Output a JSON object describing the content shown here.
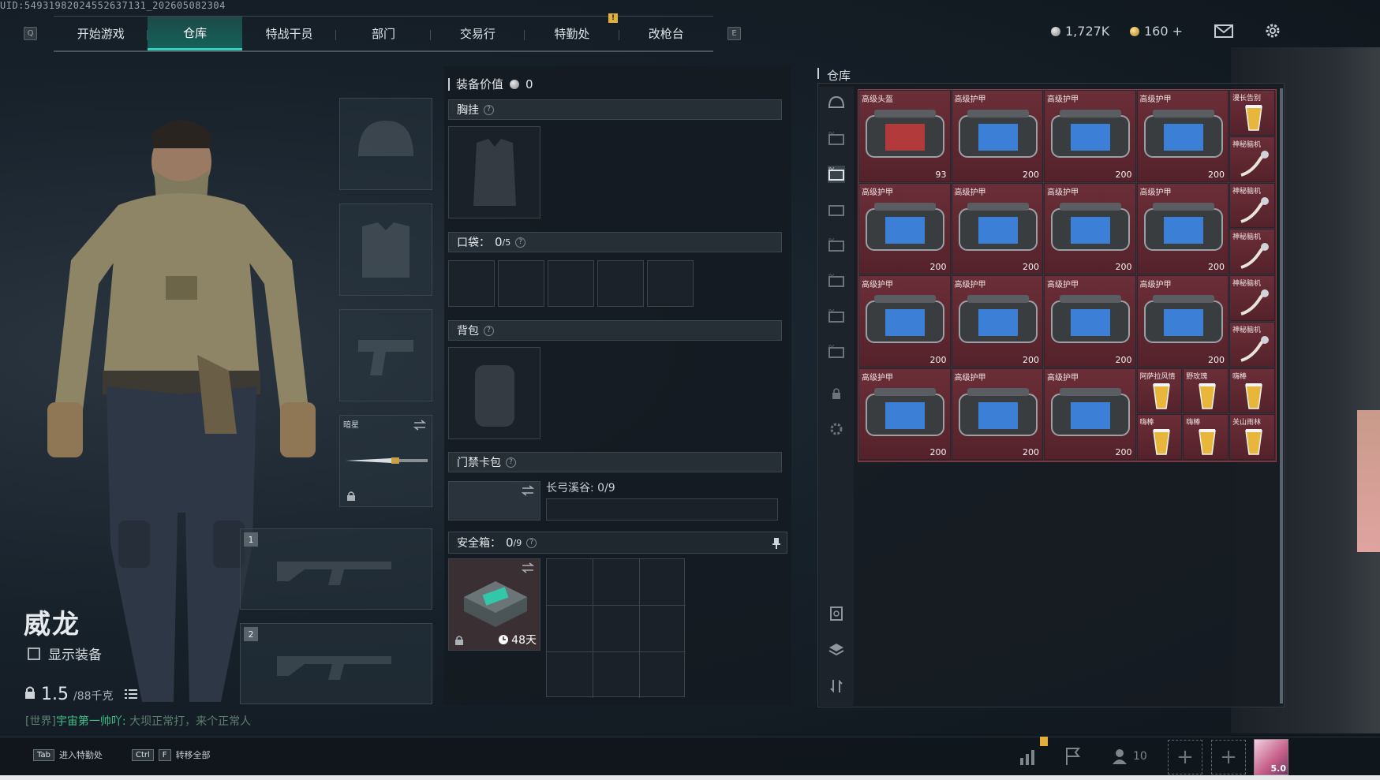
{
  "uid": "UID:549319820245526371​31_202605082304",
  "tabs": [
    {
      "label": "开始游戏"
    },
    {
      "label": "仓库"
    },
    {
      "label": "特战干员"
    },
    {
      "label": "部门"
    },
    {
      "label": "交易行"
    },
    {
      "label": "特勤处"
    },
    {
      "label": "改枪台"
    }
  ],
  "keycaps": {
    "left": "Q",
    "right": "E"
  },
  "notif": "!",
  "currency": {
    "silver": "1,727K",
    "gold": "160 +"
  },
  "character": {
    "name": "威龙",
    "show_equipment": "显示装备",
    "weight": "1.5",
    "weight_max": "/88千克"
  },
  "chat": {
    "channel": "[世界]",
    "sender": "宇宙第一帅吖:",
    "message": "大坝正常打，来个正常人"
  },
  "secondary_weapon": {
    "label": "暗星"
  },
  "weapon_slots": {
    "slot1": "1",
    "slot2": "2"
  },
  "center": {
    "value_label": "装备价值",
    "value": "0",
    "chest": "胸挂",
    "pockets": "口袋：",
    "pockets_count": "0",
    "pockets_max": "/5",
    "backpack": "背包",
    "keycard": "门禁卡包",
    "keycard_map": "长弓溪谷: 0/9",
    "safebox": "安全箱：",
    "safebox_count": "0",
    "safebox_max": "/9",
    "safebox_days": "48天"
  },
  "warehouse": {
    "title": "仓库",
    "items": [
      {
        "name": "高级头盔",
        "price": "93"
      },
      {
        "name": "高级护甲",
        "price": "200"
      },
      {
        "name": "高级护甲",
        "price": "200"
      },
      {
        "name": "高级护甲",
        "price": "200"
      },
      {
        "name": "高级护甲",
        "price": "200"
      },
      {
        "name": "高级护甲",
        "price": "200"
      },
      {
        "name": "高级护甲",
        "price": "200"
      },
      {
        "name": "高级护甲",
        "price": "200"
      },
      {
        "name": "高级护甲",
        "price": "200"
      },
      {
        "name": "高级护甲",
        "price": "200"
      },
      {
        "name": "高级护甲",
        "price": "200"
      },
      {
        "name": "高级护甲",
        "price": "200"
      },
      {
        "name": "高级护甲",
        "price": "200"
      },
      {
        "name": "高级护甲",
        "price": "200"
      },
      {
        "name": "高级护甲",
        "price": "200"
      }
    ],
    "small_items": [
      {
        "name": "漫长告别"
      },
      {
        "name": "神秘脑机"
      },
      {
        "name": "神秘脑机"
      },
      {
        "name": "神秘脑机"
      },
      {
        "name": "神秘脑机"
      },
      {
        "name": "神秘脑机"
      },
      {
        "name": "神秘脑机"
      },
      {
        "name": "阿萨拉风情"
      },
      {
        "name": "野玫瑰"
      },
      {
        "name": "嗨棒"
      },
      {
        "name": "嗨棒"
      },
      {
        "name": "嗨棒"
      },
      {
        "name": "关山雨林"
      }
    ]
  },
  "bottom": {
    "tab_key": "Tab",
    "tab_label": "进入特勤处",
    "ctrl_key": "Ctrl",
    "f_key": "F",
    "transfer_label": "转移全部",
    "friends": "10",
    "avatar_text": "5.0"
  },
  "colors": {
    "accent": "#2fd1b8",
    "item_bg": "#5a2530"
  }
}
